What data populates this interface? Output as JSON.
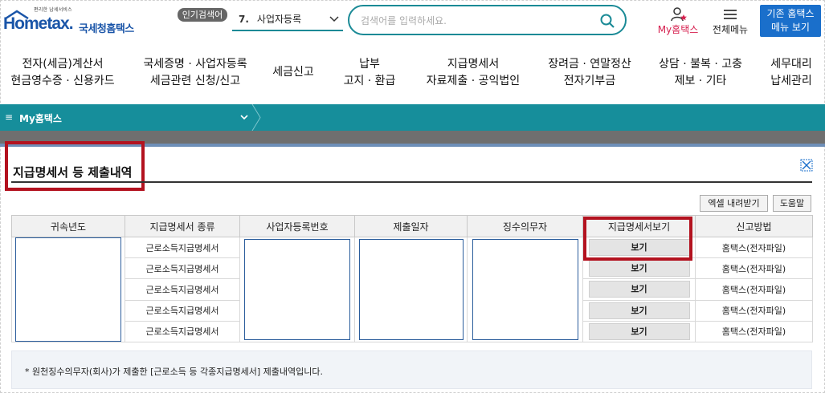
{
  "header": {
    "logo_tagline": "편리한 납세서비스",
    "logo_brand": "Hometax.",
    "logo_brand_kr": "국세청홈택스",
    "popular_badge": "인기검색어",
    "popular_rank": "7.",
    "popular_term": "사업자등록",
    "search_placeholder": "검색어를 입력하세요.",
    "myhome_label": "My홈택스",
    "allmenu_label": "전체메뉴",
    "oldmenu_line1": "기존 홈택스",
    "oldmenu_line2": "메뉴 보기"
  },
  "nav": [
    {
      "line1": "전자(세금)계산서",
      "line2": "현금영수증 · 신용카드"
    },
    {
      "line1": "국세증명 · 사업자등록",
      "line2": "세금관련 신청/신고"
    },
    {
      "line1": "세금신고",
      "line2": ""
    },
    {
      "line1": "납부",
      "line2": "고지 · 환급"
    },
    {
      "line1": "지급명세서",
      "line2": "자료제출 · 공익법인"
    },
    {
      "line1": "장려금 · 연말정산",
      "line2": "전자기부금"
    },
    {
      "line1": "상담 · 불복 · 고충",
      "line2": "제보 · 기타"
    },
    {
      "line1": "세무대리",
      "line2": "납세관리"
    }
  ],
  "breadcrumb": {
    "menu_glyph": "≡",
    "label": "My홈택스"
  },
  "page": {
    "title": "지급명세서 등 제출내역",
    "excel_button": "엑셀 내려받기",
    "help_button": "도움말"
  },
  "table": {
    "columns": [
      "귀속년도",
      "지급명세서 종류",
      "사업자등록번호",
      "제출일자",
      "징수의무자",
      "지급명세서보기",
      "신고방법"
    ],
    "rows": [
      {
        "type": "근로소득지급명세서",
        "view": "보기",
        "method": "홈택스(전자파일)"
      },
      {
        "type": "근로소득지급명세서",
        "view": "보기",
        "method": "홈택스(전자파일)"
      },
      {
        "type": "근로소득지급명세서",
        "view": "보기",
        "method": "홈택스(전자파일)"
      },
      {
        "type": "근로소득지급명세서",
        "view": "보기",
        "method": "홈택스(전자파일)"
      },
      {
        "type": "근로소득지급명세서",
        "view": "보기",
        "method": "홈택스(전자파일)"
      }
    ]
  },
  "notice": "* 원천징수의무자(회사)가 제출한 [근로소득 등 각종지급명세서] 제출내역입니다.",
  "colors": {
    "teal": "#168e9b",
    "brand_blue": "#1a55a8",
    "highlight_red": "#b3121f",
    "myhome_red": "#d6204f"
  }
}
